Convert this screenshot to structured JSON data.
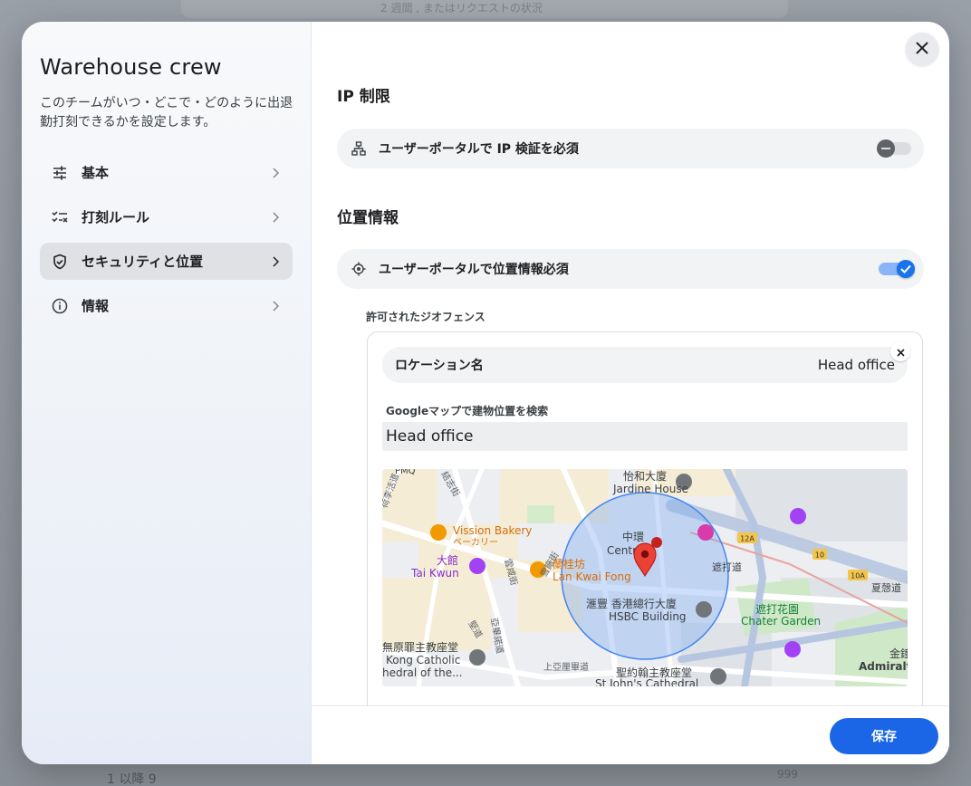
{
  "backdrop": {
    "top_text": "2 週間 , またはリクエストの状況",
    "bottom_text": "1 以降 9",
    "bottom_right": "999"
  },
  "sidebar": {
    "team_name": "Warehouse crew",
    "description": "このチームがいつ・どこで・どのように出退勤打刻できるかを設定します。",
    "items": [
      {
        "label": "基本",
        "icon": "sliders-icon"
      },
      {
        "label": "打刻ルール",
        "icon": "checklist-icon"
      },
      {
        "label": "セキュリティと位置",
        "icon": "shield-icon"
      },
      {
        "label": "情報",
        "icon": "info-icon"
      }
    ]
  },
  "main": {
    "ip_section_title": "IP 制限",
    "ip_toggle_label": "ユーザーポータルで IP 検証を必須",
    "ip_toggle_state": "off",
    "location_section_title": "位置情報",
    "location_toggle_label": "ユーザーポータルで位置情報必須",
    "location_toggle_state": "on",
    "geofence_label": "許可されたジオフェンス",
    "geofence": {
      "location_name_key": "ロケーション名",
      "location_name_value": "Head office",
      "search_label": "Googleマップで建物位置を検索",
      "search_value": "Head office"
    },
    "map": {
      "labels": {
        "jardine": "Jardine House",
        "jardine_zh": "怡和大廈",
        "vission": "Vission Bakery",
        "vission_ja": "ベーカリー",
        "taikwun_zh": "大館",
        "taikwun": "Tai Kwun",
        "lkf_zh": "蘭桂坊",
        "lkf": "Lan Kwai Fong",
        "central_zh": "中環",
        "central": "Centr",
        "hsbc_zh": "滙豐 香港總行大廈",
        "hsbc": "HSBC Building",
        "chater_zh": "遮打花園",
        "chater": "Chater Garden",
        "chater_rd": "遮打道",
        "catholic_zh": "無原罪主教座堂",
        "catholic1": "Kong Catholic",
        "catholic2": "hedral of the...",
        "stjohn_zh": "聖約翰主教座堂",
        "stjohn": "St John's Cathedral",
        "admiralty": "Admiralt",
        "admiralty_zh": "金鐘",
        "harcourt": "夏愨道",
        "pmq": "PMQ",
        "r12a": "12A",
        "r10": "10",
        "r10a": "10A",
        "st1": "雲咸街",
        "st2": "亞畢諾道",
        "st3": "雪廠街",
        "st4": "上亞厘畢道",
        "st5": "堅道",
        "st6": "荷李活道",
        "st7": "結志街"
      },
      "accent": "#4285f4",
      "pin_color": "#ea4335"
    }
  },
  "footer": {
    "save_label": "保存"
  },
  "colors": {
    "primary": "#1a66e6",
    "toggle_on": "#1a73e8",
    "row_bg": "#f1f3f4"
  }
}
